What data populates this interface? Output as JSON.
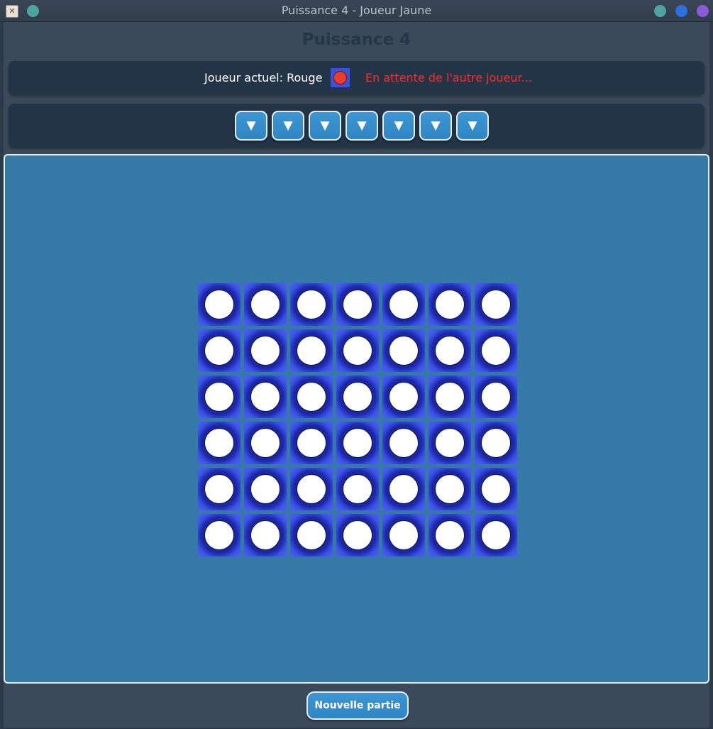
{
  "window": {
    "title": "Puissance 4 - Joueur Jaune"
  },
  "header": {
    "title": "Puissance 4"
  },
  "info": {
    "current_player_label": "Joueur actuel: Rouge",
    "current_player_color": "#ef3b2c",
    "status": "En attente de l'autre joueur..."
  },
  "columns": {
    "count": 7,
    "button_glyph": "▼",
    "icon": "down-arrow-icon"
  },
  "board": {
    "rows": 6,
    "cols": 7,
    "cells": [
      [
        "empty",
        "empty",
        "empty",
        "empty",
        "empty",
        "empty",
        "empty"
      ],
      [
        "empty",
        "empty",
        "empty",
        "empty",
        "empty",
        "empty",
        "empty"
      ],
      [
        "empty",
        "empty",
        "empty",
        "empty",
        "empty",
        "empty",
        "empty"
      ],
      [
        "empty",
        "empty",
        "empty",
        "empty",
        "empty",
        "empty",
        "empty"
      ],
      [
        "empty",
        "empty",
        "empty",
        "empty",
        "empty",
        "empty",
        "empty"
      ],
      [
        "empty",
        "empty",
        "empty",
        "empty",
        "empty",
        "empty",
        "empty"
      ]
    ],
    "colors": {
      "board": "#3b52e6",
      "empty": "#ffffff",
      "rouge": "#ef3b2c",
      "jaune": "#f5d20b"
    }
  },
  "footer": {
    "new_game_label": "Nouvelle partie"
  },
  "colors": {
    "accent": "#2f85c4",
    "status": "#ff2a2a",
    "background": "#3579a6"
  }
}
